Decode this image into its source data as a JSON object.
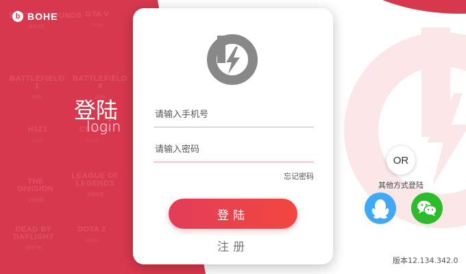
{
  "brand": {
    "mark": "b",
    "name": "BOHE"
  },
  "hero": {
    "title_cn": "登陆",
    "title_en": "login"
  },
  "games": [
    {
      "logo": "BATTLEGROUNDS",
      "caption": "绝地求生"
    },
    {
      "logo": "GTA V",
      "caption": "GTA5"
    },
    {
      "logo": "BATTLEFIELD 1",
      "caption": "战地1"
    },
    {
      "logo": "BATTLEFIELD 4",
      "caption": "战地4"
    },
    {
      "logo": "H1Z1",
      "caption": "H1Z1"
    },
    {
      "logo": "CS:GO",
      "caption": "CSGO"
    },
    {
      "logo": "THE DIVISION",
      "caption": "全境封锁"
    },
    {
      "logo": "LEAGUE OF LEGENDS",
      "caption": "英雄联盟"
    },
    {
      "logo": "DEAD BY DAYLIGHT",
      "caption": "黎明杀机"
    },
    {
      "logo": "DOTA 2",
      "caption": "DOTA2"
    }
  ],
  "form": {
    "phone_placeholder": "请输入手机号",
    "password_placeholder": "请输入密码",
    "forgot_label": "忘记密码",
    "login_label": "登陆",
    "register_label": "注册"
  },
  "alt_login": {
    "or_label": "OR",
    "other_label": "其他方式登陆",
    "qq_icon": "qq-penguin-icon",
    "wechat_icon": "wechat-icon"
  },
  "version": "版本12.134.342.0",
  "colors": {
    "brand_red": "#d8384d",
    "qq_blue": "#3fa9f5",
    "wechat_green": "#2bbb2b",
    "logo_gray": "#888888"
  }
}
